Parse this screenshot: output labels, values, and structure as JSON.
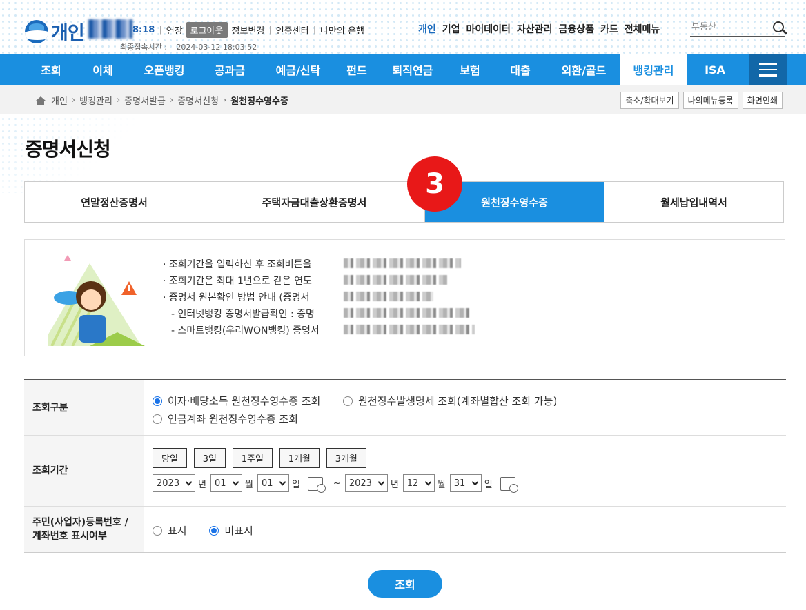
{
  "header": {
    "logo_text": "개인",
    "session_time": "8:18",
    "extend_label": "연장",
    "logout_label": "로그아웃",
    "links": [
      "정보변경",
      "인증센터",
      "나만의 은행"
    ],
    "last_login_label": "최종접속시간 :",
    "last_login_value": "2024-03-12 18:03:52",
    "gnb": [
      "개인",
      "기업",
      "마이데이터",
      "자산관리",
      "금융상품",
      "카드",
      "전체메뉴"
    ],
    "search_placeholder": "부동산"
  },
  "main_nav": {
    "items": [
      "조회",
      "이체",
      "오픈뱅킹",
      "공과금",
      "예금/신탁",
      "펀드",
      "퇴직연금",
      "보험",
      "대출",
      "외환/골드",
      "뱅킹관리",
      "ISA"
    ],
    "active": "뱅킹관리"
  },
  "breadcrumb": {
    "items": [
      "개인",
      "뱅킹관리",
      "증명서발급",
      "증명서신청"
    ],
    "current": "원천징수영수증"
  },
  "utility_buttons": [
    "축소/확대보기",
    "나의메뉴등록",
    "화면인쇄"
  ],
  "page_title": "증명서신청",
  "tabs": [
    {
      "label": "연말정산증명서",
      "active": false
    },
    {
      "label": "주택자금대출상환증명서",
      "active": false
    },
    {
      "label": "원천징수영수증",
      "active": true
    },
    {
      "label": "월세납입내역서",
      "active": false
    }
  ],
  "step_badge": "3",
  "notice": {
    "items": [
      "· 조회기간을 입력하신 후 조회버튼을",
      "· 조회기간은 최대 1년으로 같은 연도",
      "· 증명서 원본확인 방법 안내 (증명서",
      "- 인터넷뱅킹 증명서발급확인 : 증명",
      "- 스마트뱅킹(우리WON뱅킹) 증명서"
    ]
  },
  "form": {
    "type_label": "조회구분",
    "type_options": [
      {
        "label": "이자·배당소득 원천징수영수증 조회",
        "checked": true
      },
      {
        "label": "원천징수발생명세 조회(계좌별합산 조회 가능)",
        "checked": false
      },
      {
        "label": "연금계좌 원천징수영수증 조회",
        "checked": false
      }
    ],
    "period_label": "조회기간",
    "quick_buttons": [
      "당일",
      "3일",
      "1주일",
      "1개월",
      "3개월"
    ],
    "start": {
      "year": "2023",
      "month": "01",
      "day": "01"
    },
    "end": {
      "year": "2023",
      "month": "12",
      "day": "31"
    },
    "units": {
      "year": "년",
      "month": "월",
      "day": "일",
      "tilde": "~"
    },
    "id_label_1": "주민(사업자)등록번호 /",
    "id_label_2": "계좌번호 표시여부",
    "id_options": [
      {
        "label": "표시",
        "checked": false
      },
      {
        "label": "미표시",
        "checked": true
      }
    ]
  },
  "submit_label": "조회",
  "colors": {
    "primary": "#1a8fe0",
    "badge": "#e81818",
    "logo": "#1b5fb0"
  }
}
